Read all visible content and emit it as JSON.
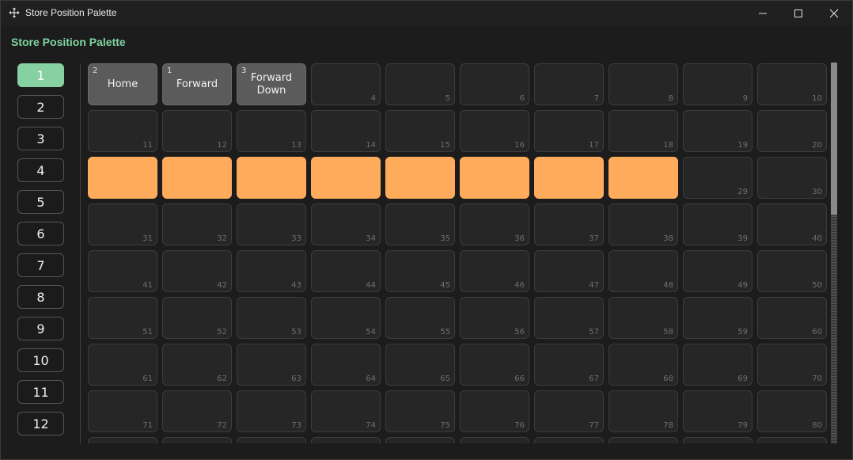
{
  "window": {
    "title": "Store Position Palette"
  },
  "palette": {
    "title": "Store Position Palette"
  },
  "pages": [
    "1",
    "2",
    "3",
    "4",
    "5",
    "6",
    "7",
    "8",
    "9",
    "10",
    "11",
    "12"
  ],
  "active_page": 0,
  "grid": {
    "columns": 10,
    "visible_rows": 9,
    "stored": [
      {
        "slot": 1,
        "count": "2",
        "label": "Home"
      },
      {
        "slot": 2,
        "count": "1",
        "label": "Forward"
      },
      {
        "slot": 3,
        "count": "3",
        "label": "Forward\nDown"
      }
    ],
    "highlighted": [
      21,
      22,
      23,
      24,
      25,
      26,
      27,
      28
    ]
  },
  "colors": {
    "accent": "#86d0a2",
    "title_green": "#7fd6a2",
    "highlight": "#ffab5c",
    "stored": "#5b5b5b",
    "empty": "#262626"
  },
  "icons": {
    "move": "move-icon",
    "minimize": "minimize-icon",
    "maximize": "maximize-icon",
    "close": "close-icon"
  }
}
